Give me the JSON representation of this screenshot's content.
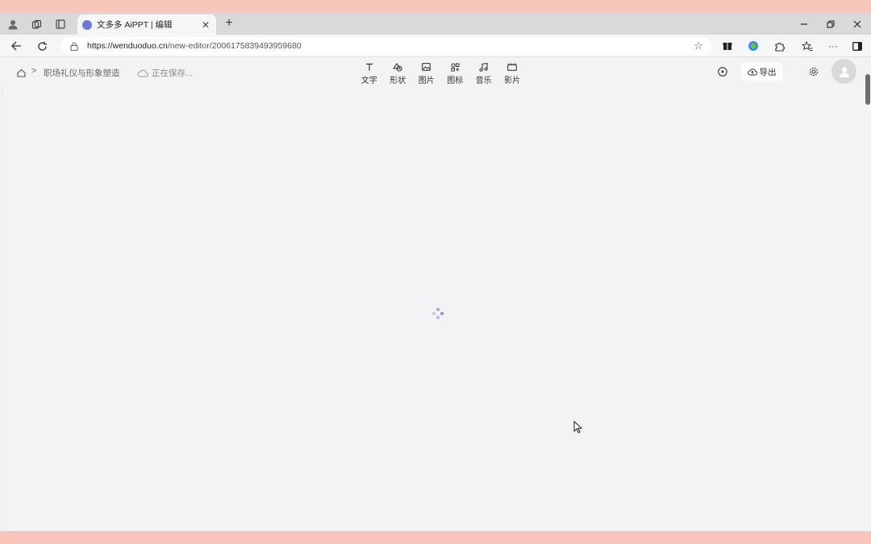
{
  "browser": {
    "tab": {
      "title": "文多多 AiPPT | 编辑"
    },
    "url": {
      "host": "https://wenduoduo.cn",
      "path": "/new-editor/2006175839493959680"
    }
  },
  "app": {
    "breadcrumb": {
      "doc_title": "职场礼仪与形象塑造"
    },
    "save_status": "正在保存...",
    "toolbar": [
      {
        "label": "文字",
        "icon": "text-icon"
      },
      {
        "label": "形状",
        "icon": "shape-icon"
      },
      {
        "label": "图片",
        "icon": "image-icon"
      },
      {
        "label": "图标",
        "icon": "icons-icon"
      },
      {
        "label": "音乐",
        "icon": "music-icon"
      },
      {
        "label": "影片",
        "icon": "video-icon"
      }
    ],
    "export_label": "导出"
  },
  "colors": {
    "accent": "#6f7ad8",
    "spinner": "#a6a2f0",
    "frame": "#f9c6bc"
  }
}
